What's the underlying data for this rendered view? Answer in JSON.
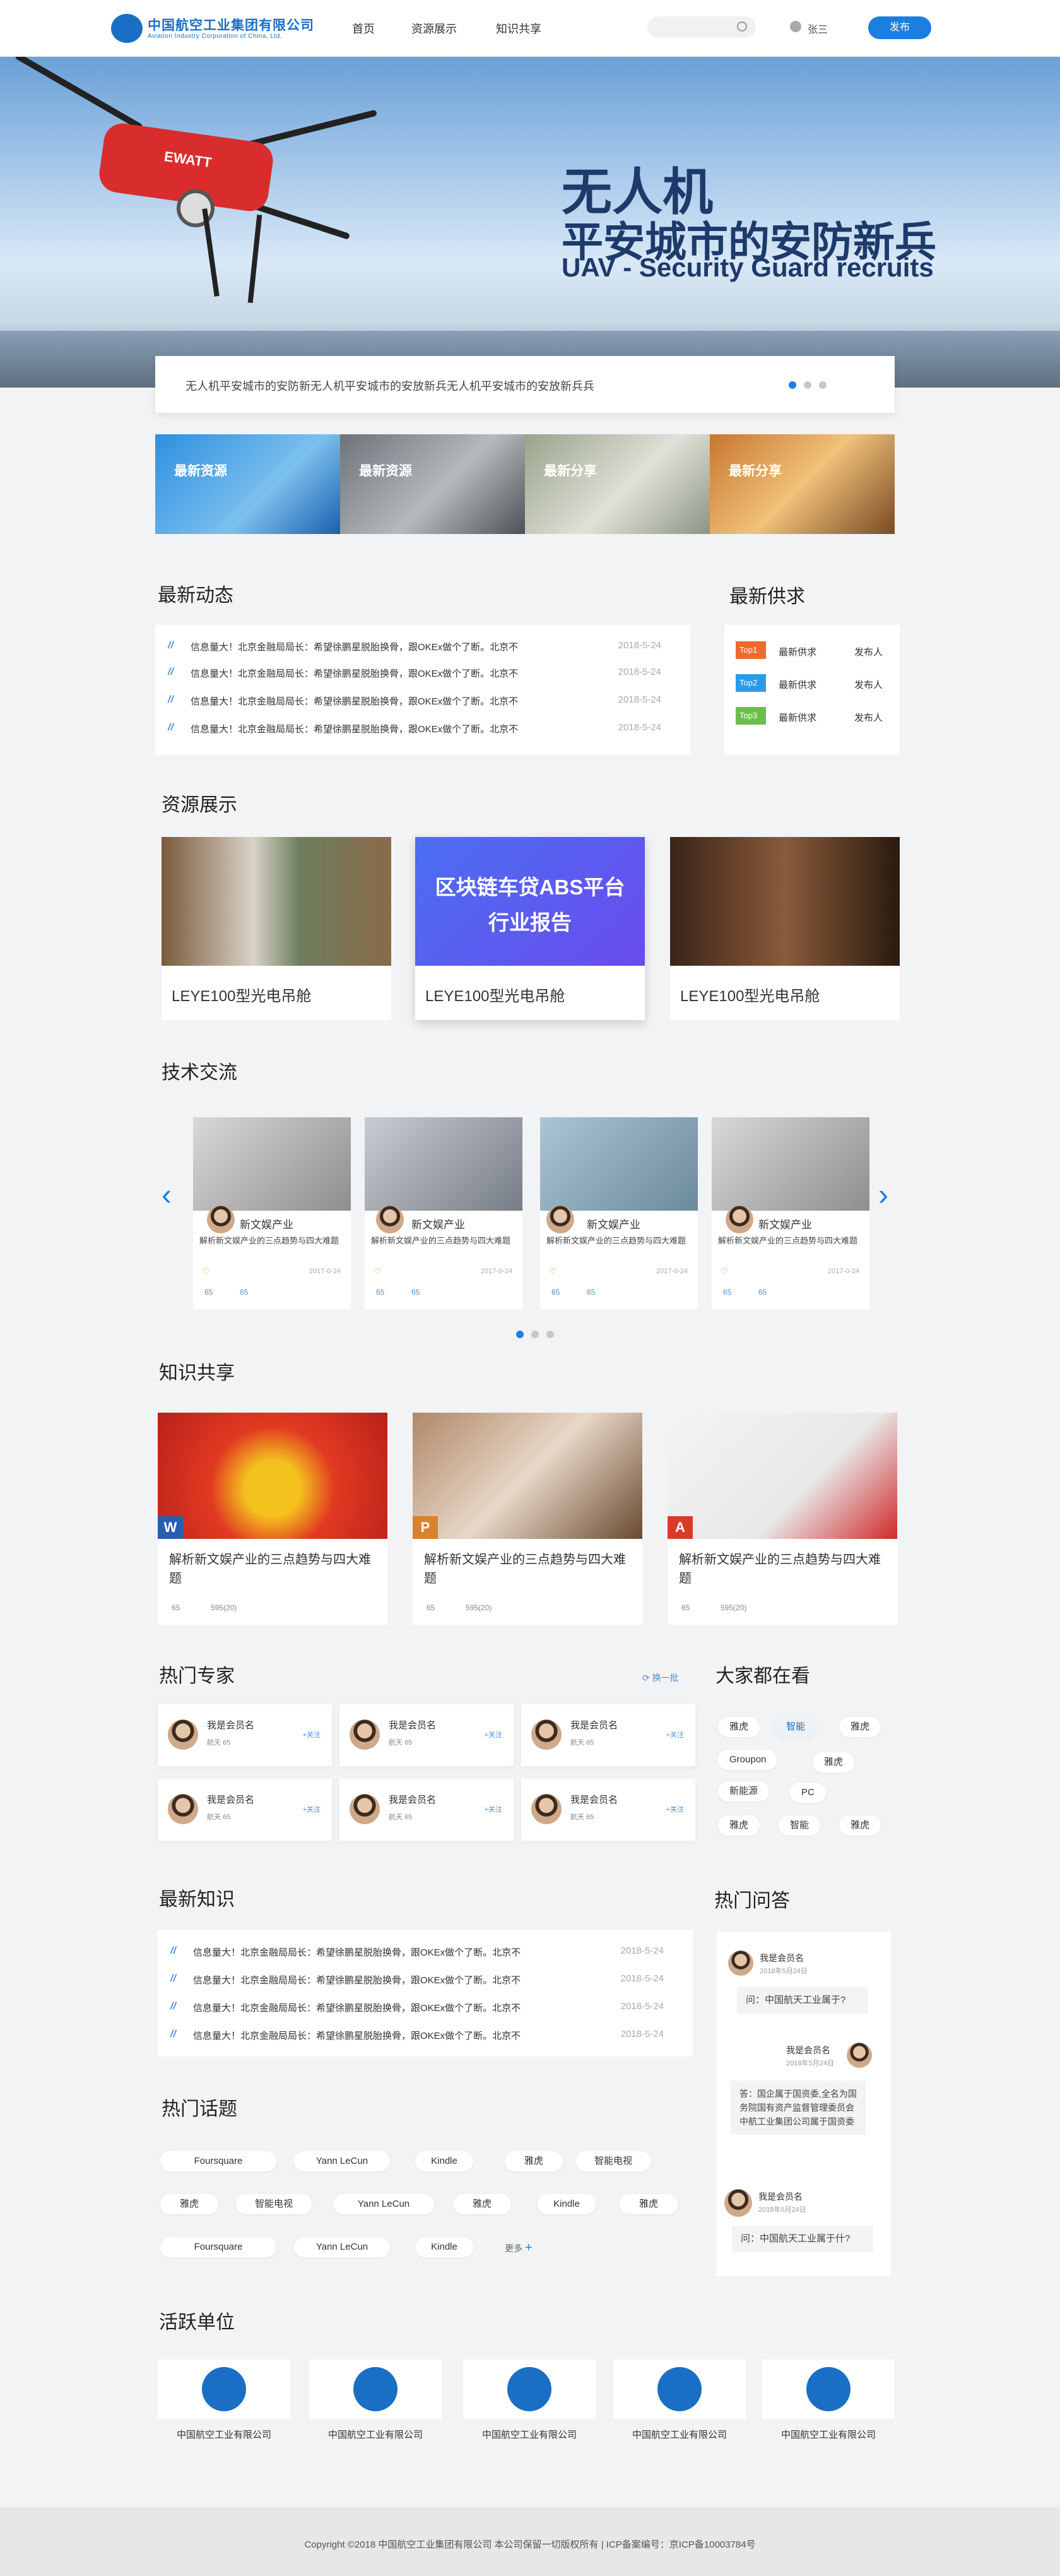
{
  "header": {
    "logo_cn": "中国航空工业集团有限公司",
    "logo_en": "Aviation Industry Corporation of China, Ltd.",
    "nav": [
      "首页",
      "资源展示",
      "知识共享"
    ],
    "user": "张三",
    "publish": "发布"
  },
  "banner": {
    "title": "无人机",
    "subtitle": "平安城市的安防新兵",
    "subtitle_en": "UAV - Security Guard recruits",
    "drone_brand": "EWATT",
    "notice": "无人机平安城市的安防新无人机平安城市的安放新兵无人机平安城市的安放新兵兵"
  },
  "tiles": [
    "最新资源",
    "最新资源",
    "最新分享",
    "最新分享"
  ],
  "latest_news": {
    "title": "最新动态",
    "items": [
      {
        "text": "信息量大！北京金融局局长：希望徐鹏星脱胎换骨，跟OKEx做个了断。北京不",
        "date": "2018-5-24"
      },
      {
        "text": "信息量大！北京金融局局长：希望徐鹏星脱胎换骨，跟OKEx做个了断。北京不",
        "date": "2018-5-24"
      },
      {
        "text": "信息量大！北京金融局局长：希望徐鹏星脱胎换骨，跟OKEx做个了断。北京不",
        "date": "2018-5-24"
      },
      {
        "text": "信息量大！北京金融局局长：希望徐鹏星脱胎换骨，跟OKEx做个了断。北京不",
        "date": "2018-5-24"
      }
    ]
  },
  "supply": {
    "title": "最新供求",
    "items": [
      {
        "tag": "Top1",
        "color": "#f06a2b",
        "text": "最新供求",
        "pub": "发布人"
      },
      {
        "tag": "Top2",
        "color": "#2b9be8",
        "text": "最新供求",
        "pub": "发布人"
      },
      {
        "tag": "Top3",
        "color": "#6cc04a",
        "text": "最新供求",
        "pub": "发布人"
      }
    ]
  },
  "resources": {
    "title": "资源展示",
    "items": [
      {
        "caption": "LEYE100型光电吊舱"
      },
      {
        "caption": "LEYE100型光电吊舱",
        "overlay1": "区块链车贷ABS平台",
        "overlay2": "行业报告"
      },
      {
        "caption": "LEYE100型光电吊舱"
      }
    ]
  },
  "tech": {
    "title": "技术交流",
    "items": [
      {
        "name": "新文娱产业",
        "desc": "解析新文娱产业的三点趋势与四大难题",
        "date": "2017-0-24",
        "likes": "65",
        "comments": "65"
      },
      {
        "name": "新文娱产业",
        "desc": "解析新文娱产业的三点趋势与四大难题",
        "date": "2017-0-24",
        "likes": "65",
        "comments": "65"
      },
      {
        "name": "新文娱产业",
        "desc": "解析新文娱产业的三点趋势与四大难题",
        "date": "2017-0-24",
        "likes": "65",
        "comments": "65"
      },
      {
        "name": "新文娱产业",
        "desc": "解析新文娱产业的三点趋势与四大难题",
        "date": "2017-0-24",
        "likes": "65",
        "comments": "65"
      }
    ]
  },
  "knowledge": {
    "title": "知识共享",
    "items": [
      {
        "doc": "W",
        "color": "#2a5db0",
        "title": "解析新文娱产业的三点趋势与四大难题",
        "views": "65",
        "downloads": "595(20)"
      },
      {
        "doc": "P",
        "color": "#d9822b",
        "title": "解析新文娱产业的三点趋势与四大难题",
        "views": "65",
        "downloads": "595(20)"
      },
      {
        "doc": "A",
        "color": "#d93b2b",
        "title": "解析新文娱产业的三点趋势与四大难题",
        "views": "65",
        "downloads": "595(20)"
      }
    ]
  },
  "experts": {
    "title": "热门专家",
    "refresh": "换一批",
    "items": [
      {
        "name": "我是会员名",
        "meta1": "航天",
        "meta2": "65",
        "follow": "+关注"
      },
      {
        "name": "我是会员名",
        "meta1": "航天",
        "meta2": "65",
        "follow": "+关注"
      },
      {
        "name": "我是会员名",
        "meta1": "航天",
        "meta2": "65",
        "follow": "+关注"
      },
      {
        "name": "我是会员名",
        "meta1": "航天",
        "meta2": "65",
        "follow": "+关注"
      },
      {
        "name": "我是会员名",
        "meta1": "航天",
        "meta2": "65",
        "follow": "+关注"
      },
      {
        "name": "我是会员名",
        "meta1": "航天",
        "meta2": "65",
        "follow": "+关注"
      }
    ]
  },
  "watching": {
    "title": "大家都在看",
    "tags": [
      "雅虎",
      "智能",
      "雅虎",
      "Groupon",
      "雅虎",
      "新能源",
      "PC",
      "雅虎",
      "智能",
      "雅虎"
    ]
  },
  "latest_knowledge": {
    "title": "最新知识",
    "items": [
      {
        "text": "信息量大！北京金融局局长：希望徐鹏星脱胎换骨，跟OKEx做个了断。北京不",
        "date": "2018-5-24"
      },
      {
        "text": "信息量大！北京金融局局长：希望徐鹏星脱胎换骨，跟OKEx做个了断。北京不",
        "date": "2018-5-24"
      },
      {
        "text": "信息量大！北京金融局局长：希望徐鹏星脱胎换骨，跟OKEx做个了断。北京不",
        "date": "2018-5-24"
      },
      {
        "text": "信息量大！北京金融局局长：希望徐鹏星脱胎换骨，跟OKEx做个了断。北京不",
        "date": "2018-5-24"
      }
    ]
  },
  "hot_topics": {
    "title": "热门话题",
    "tags": [
      "Foursquare",
      "Yann LeCun",
      "Kindle",
      "雅虎",
      "智能电视",
      "雅虎",
      "智能电视",
      "Yann LeCun",
      "雅虎",
      "Kindle",
      "雅虎",
      "Foursquare",
      "Yann LeCun",
      "Kindle"
    ],
    "more": "更多"
  },
  "qa": {
    "title": "热门问答",
    "items": [
      {
        "name": "我是会员名",
        "date": "2018年5月24日",
        "text": "问：中国航天工业属于?"
      },
      {
        "name": "我是会员名",
        "date": "2018年5月24日",
        "text": "答：国企属于国资委,全名为国务院国有资产监督管理委员会 中航工业集团公司属于国资委"
      },
      {
        "name": "我是会员名",
        "date": "2018年5月24日",
        "text": "问：中国航天工业属于什?"
      }
    ]
  },
  "units": {
    "title": "活跃单位",
    "items": [
      "中国航空工业有限公司",
      "中国航空工业有限公司",
      "中国航空工业有限公司",
      "中国航空工业有限公司",
      "中国航空工业有限公司"
    ]
  },
  "footer": {
    "text": "Copyright  ©2018  中国航空工业集团有限公司    本公司保留一切版权所有  |  ICP备案编号：京ICP备10003784号"
  }
}
